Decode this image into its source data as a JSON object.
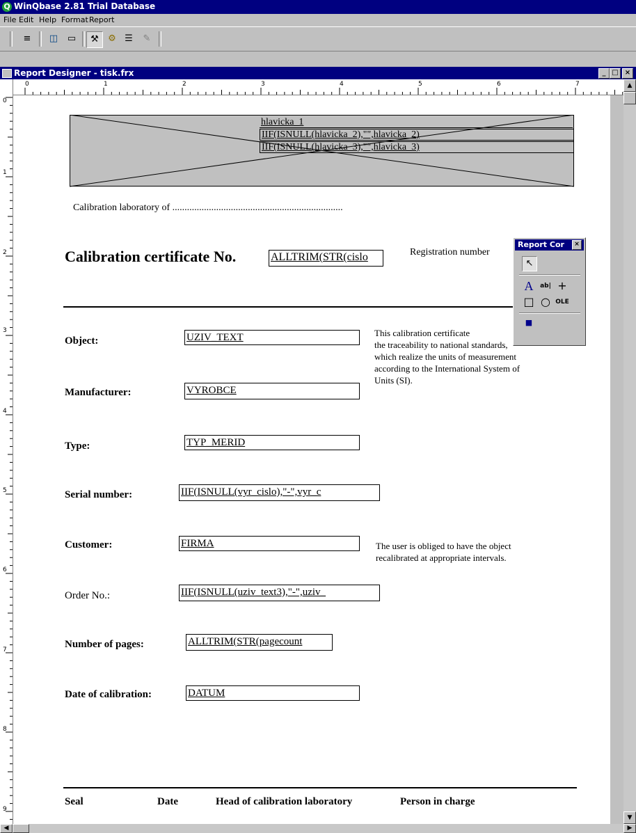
{
  "app": {
    "title": "WinQbase 2.81  Trial Database"
  },
  "menu": [
    "File",
    "Edit",
    "Help",
    "Format",
    "Report"
  ],
  "toolbar_icons": [
    "list-icon",
    "network-icon",
    "document-icon",
    "tools-icon",
    "gear-icon",
    "align-icon",
    "eraser-icon"
  ],
  "child_window": {
    "title": "Report Designer - tisk.frx"
  },
  "ruler": {
    "h_labels": [
      "0",
      "1",
      "2",
      "3",
      "4",
      "5",
      "6",
      "7"
    ],
    "v_labels": [
      "0",
      "1",
      "2",
      "3",
      "4",
      "5",
      "6",
      "7",
      "8",
      "9"
    ]
  },
  "header_lines": [
    "hlavicka_1",
    "IIF(ISNULL(hlavicka_2),\"\",hlavicka_2)",
    "IIF(ISNULL(hlavicka_3),\"\",hlavicka_3)"
  ],
  "lab_line": "Calibration laboratory of ......................................................................",
  "certificate": {
    "title": "Calibration certificate No.",
    "field": "ALLTRIM(STR(cislo",
    "registration": "Registration number"
  },
  "fields": [
    {
      "label": "Object:",
      "value": "UZIV_TEXT"
    },
    {
      "label": "Manufacturer:",
      "value": "VYROBCE"
    },
    {
      "label": "Type:",
      "value": "TYP_MERID"
    },
    {
      "label": "Serial number:",
      "value": "IIF(ISNULL(vyr_cislo),\"-\",vyr_c"
    },
    {
      "label": "Customer:",
      "value": "FIRMA"
    },
    {
      "label": "Order No.:",
      "value": "IIF(ISNULL(uziv_text3),\"-\",uziv_"
    },
    {
      "label": "Number of pages:",
      "value": "ALLTRIM(STR(pagecount"
    },
    {
      "label": "Date of calibration:",
      "value": "DATUM"
    }
  ],
  "note1": [
    "This calibration certificate",
    "the traceability to national standards,",
    "which realize the units of measurement",
    "according to the International System of",
    "Units (SI)."
  ],
  "note2": [
    "The user is obliged to have the object",
    "recalibrated at appropriate intervals."
  ],
  "footer": [
    "Seal",
    "Date",
    "Head of calibration laboratory",
    "Person in charge"
  ],
  "toolbox": {
    "title": "Report Cor"
  }
}
